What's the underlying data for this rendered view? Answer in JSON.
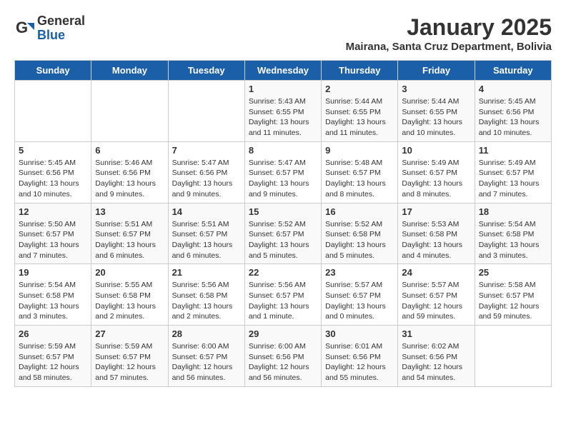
{
  "header": {
    "logo_general": "General",
    "logo_blue": "Blue",
    "month_title": "January 2025",
    "location": "Mairana, Santa Cruz Department, Bolivia"
  },
  "weekdays": [
    "Sunday",
    "Monday",
    "Tuesday",
    "Wednesday",
    "Thursday",
    "Friday",
    "Saturday"
  ],
  "weeks": [
    [
      {
        "day": "",
        "info": ""
      },
      {
        "day": "",
        "info": ""
      },
      {
        "day": "",
        "info": ""
      },
      {
        "day": "1",
        "info": "Sunrise: 5:43 AM\nSunset: 6:55 PM\nDaylight: 13 hours\nand 11 minutes."
      },
      {
        "day": "2",
        "info": "Sunrise: 5:44 AM\nSunset: 6:55 PM\nDaylight: 13 hours\nand 11 minutes."
      },
      {
        "day": "3",
        "info": "Sunrise: 5:44 AM\nSunset: 6:55 PM\nDaylight: 13 hours\nand 10 minutes."
      },
      {
        "day": "4",
        "info": "Sunrise: 5:45 AM\nSunset: 6:56 PM\nDaylight: 13 hours\nand 10 minutes."
      }
    ],
    [
      {
        "day": "5",
        "info": "Sunrise: 5:45 AM\nSunset: 6:56 PM\nDaylight: 13 hours\nand 10 minutes."
      },
      {
        "day": "6",
        "info": "Sunrise: 5:46 AM\nSunset: 6:56 PM\nDaylight: 13 hours\nand 9 minutes."
      },
      {
        "day": "7",
        "info": "Sunrise: 5:47 AM\nSunset: 6:56 PM\nDaylight: 13 hours\nand 9 minutes."
      },
      {
        "day": "8",
        "info": "Sunrise: 5:47 AM\nSunset: 6:57 PM\nDaylight: 13 hours\nand 9 minutes."
      },
      {
        "day": "9",
        "info": "Sunrise: 5:48 AM\nSunset: 6:57 PM\nDaylight: 13 hours\nand 8 minutes."
      },
      {
        "day": "10",
        "info": "Sunrise: 5:49 AM\nSunset: 6:57 PM\nDaylight: 13 hours\nand 8 minutes."
      },
      {
        "day": "11",
        "info": "Sunrise: 5:49 AM\nSunset: 6:57 PM\nDaylight: 13 hours\nand 7 minutes."
      }
    ],
    [
      {
        "day": "12",
        "info": "Sunrise: 5:50 AM\nSunset: 6:57 PM\nDaylight: 13 hours\nand 7 minutes."
      },
      {
        "day": "13",
        "info": "Sunrise: 5:51 AM\nSunset: 6:57 PM\nDaylight: 13 hours\nand 6 minutes."
      },
      {
        "day": "14",
        "info": "Sunrise: 5:51 AM\nSunset: 6:57 PM\nDaylight: 13 hours\nand 6 minutes."
      },
      {
        "day": "15",
        "info": "Sunrise: 5:52 AM\nSunset: 6:57 PM\nDaylight: 13 hours\nand 5 minutes."
      },
      {
        "day": "16",
        "info": "Sunrise: 5:52 AM\nSunset: 6:58 PM\nDaylight: 13 hours\nand 5 minutes."
      },
      {
        "day": "17",
        "info": "Sunrise: 5:53 AM\nSunset: 6:58 PM\nDaylight: 13 hours\nand 4 minutes."
      },
      {
        "day": "18",
        "info": "Sunrise: 5:54 AM\nSunset: 6:58 PM\nDaylight: 13 hours\nand 3 minutes."
      }
    ],
    [
      {
        "day": "19",
        "info": "Sunrise: 5:54 AM\nSunset: 6:58 PM\nDaylight: 13 hours\nand 3 minutes."
      },
      {
        "day": "20",
        "info": "Sunrise: 5:55 AM\nSunset: 6:58 PM\nDaylight: 13 hours\nand 2 minutes."
      },
      {
        "day": "21",
        "info": "Sunrise: 5:56 AM\nSunset: 6:58 PM\nDaylight: 13 hours\nand 2 minutes."
      },
      {
        "day": "22",
        "info": "Sunrise: 5:56 AM\nSunset: 6:57 PM\nDaylight: 13 hours\nand 1 minute."
      },
      {
        "day": "23",
        "info": "Sunrise: 5:57 AM\nSunset: 6:57 PM\nDaylight: 13 hours\nand 0 minutes."
      },
      {
        "day": "24",
        "info": "Sunrise: 5:57 AM\nSunset: 6:57 PM\nDaylight: 12 hours\nand 59 minutes."
      },
      {
        "day": "25",
        "info": "Sunrise: 5:58 AM\nSunset: 6:57 PM\nDaylight: 12 hours\nand 59 minutes."
      }
    ],
    [
      {
        "day": "26",
        "info": "Sunrise: 5:59 AM\nSunset: 6:57 PM\nDaylight: 12 hours\nand 58 minutes."
      },
      {
        "day": "27",
        "info": "Sunrise: 5:59 AM\nSunset: 6:57 PM\nDaylight: 12 hours\nand 57 minutes."
      },
      {
        "day": "28",
        "info": "Sunrise: 6:00 AM\nSunset: 6:57 PM\nDaylight: 12 hours\nand 56 minutes."
      },
      {
        "day": "29",
        "info": "Sunrise: 6:00 AM\nSunset: 6:56 PM\nDaylight: 12 hours\nand 56 minutes."
      },
      {
        "day": "30",
        "info": "Sunrise: 6:01 AM\nSunset: 6:56 PM\nDaylight: 12 hours\nand 55 minutes."
      },
      {
        "day": "31",
        "info": "Sunrise: 6:02 AM\nSunset: 6:56 PM\nDaylight: 12 hours\nand 54 minutes."
      },
      {
        "day": "",
        "info": ""
      }
    ]
  ]
}
